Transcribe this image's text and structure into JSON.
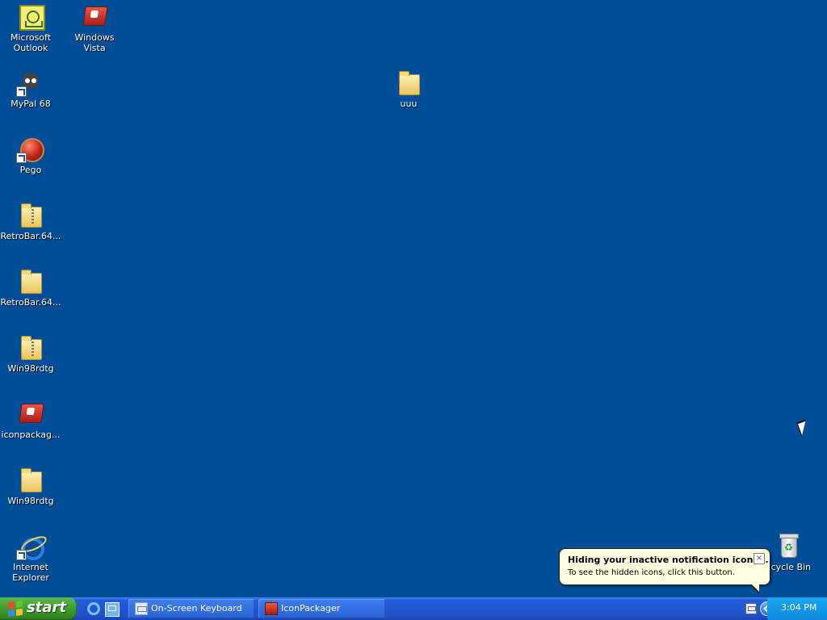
{
  "desktop": {
    "icons": [
      {
        "label": "Microsoft Outlook"
      },
      {
        "label": "Windows Vista"
      },
      {
        "label": "MyPal 68"
      },
      {
        "label": "uuu"
      },
      {
        "label": "Pego"
      },
      {
        "label": "RetroBar.64..."
      },
      {
        "label": "RetroBar.64..."
      },
      {
        "label": "Win98rdtg"
      },
      {
        "label": "iconpackag..."
      },
      {
        "label": "Win98rdtg"
      },
      {
        "label": "Internet Explorer"
      },
      {
        "label": "ecycle Bin"
      }
    ]
  },
  "notification": {
    "title": "Hiding your inactive notification icons...",
    "text": "To see the hidden icons, click this button.",
    "close_label": "×"
  },
  "taskbar": {
    "start_label": "start",
    "tasks": [
      {
        "label": "On-Screen Keyboard"
      },
      {
        "label": "IconPackager"
      }
    ],
    "clock": "3:04 PM"
  },
  "icons": {
    "outlook": "outlook-icon",
    "vista": "windows-vista-icon",
    "mypal": "mypal-icon",
    "folder": "folder-icon",
    "pego": "pego-icon",
    "zip_folder": "compressed-folder-icon",
    "iconpackager": "iconpackager-icon",
    "ie": "internet-explorer-icon",
    "recycle": "recycle-bin-icon",
    "keyboard": "keyboard-icon",
    "chevron": "show-hidden-icons-icon",
    "mail": "mail-icon"
  },
  "colors": {
    "desktop": "#004e98",
    "taskbar": "#245edb",
    "start": "#3f9c2e",
    "notification": "#ffffe1",
    "tray": "#0f88dc"
  }
}
